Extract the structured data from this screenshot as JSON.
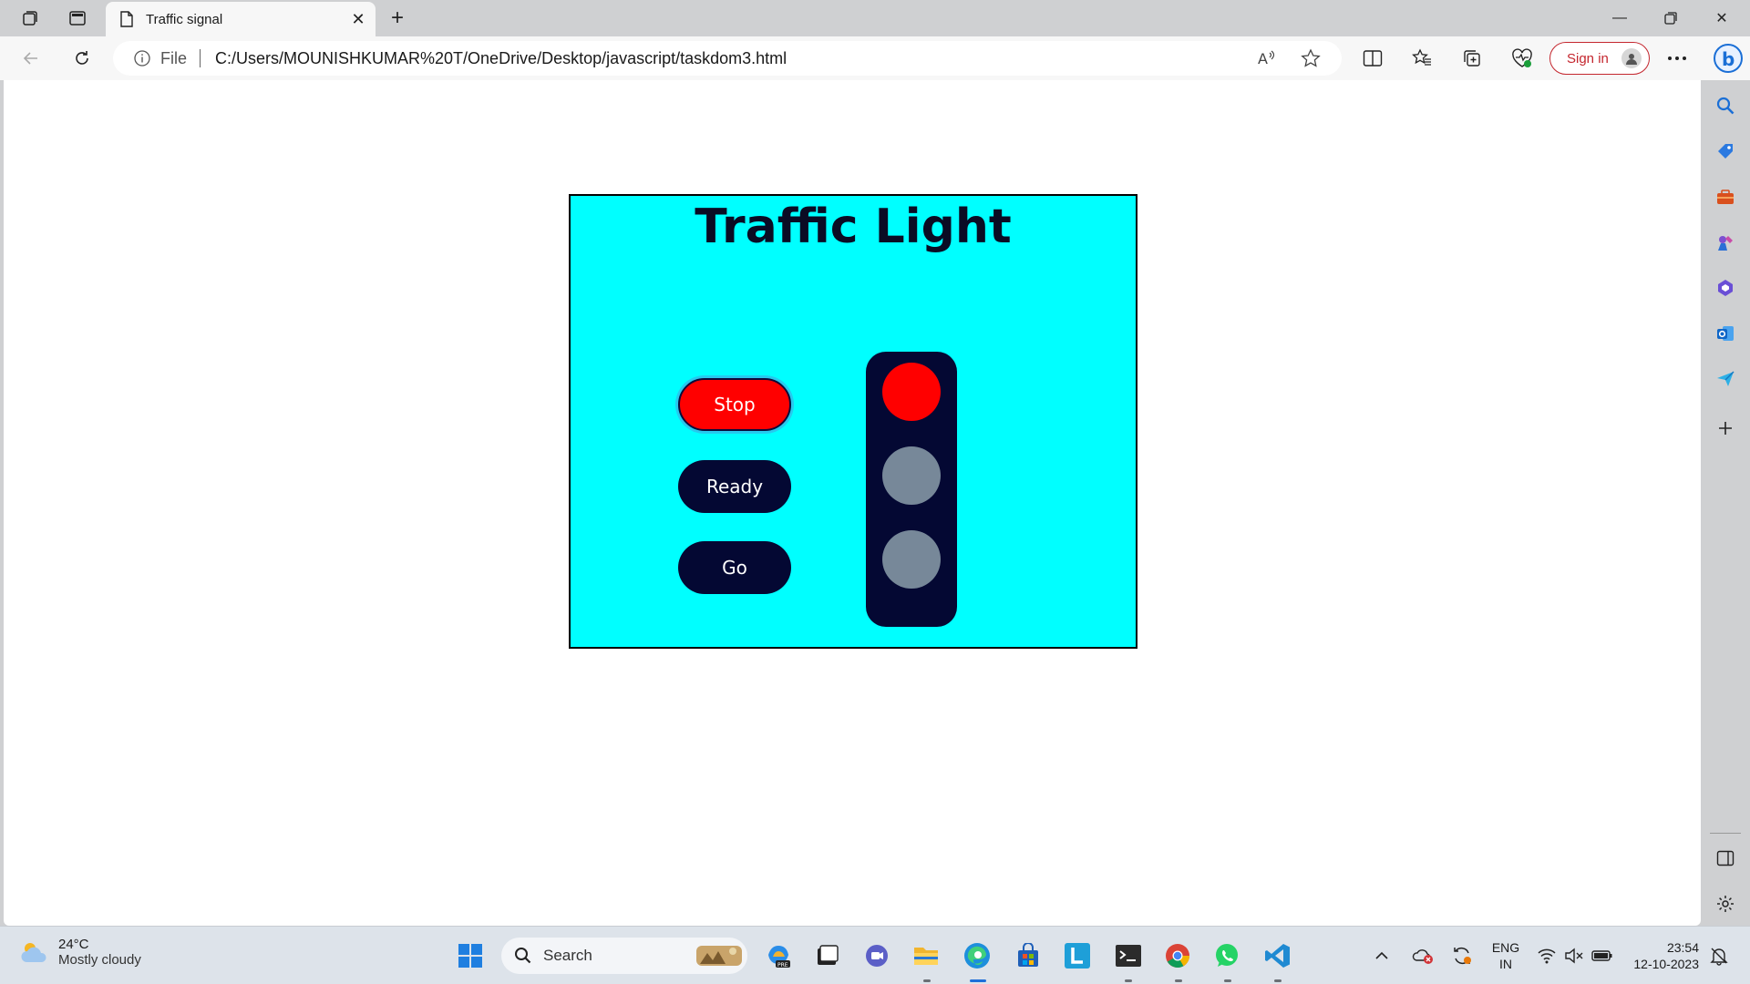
{
  "browser": {
    "tab_title": "Traffic signal",
    "address": {
      "file_label": "File",
      "url": "C:/Users/MOUNISHKUMAR%20T/OneDrive/Desktop/javascript/taskdom3.html"
    },
    "signin_label": "Sign in"
  },
  "page": {
    "title": "Traffic Light",
    "buttons": {
      "stop": "Stop",
      "ready": "Ready",
      "go": "Go"
    },
    "colors": {
      "panel_background": "#00ffff",
      "stop_button": "#ff0000",
      "button_dark": "#040833",
      "lamp_red_on": "#ff0000",
      "lamp_off": "#778899"
    },
    "active_light": "red"
  },
  "sidebar": {
    "icons": [
      "search-icon",
      "tag-icon",
      "toolbox-icon",
      "games-icon",
      "office-icon",
      "outlook-icon",
      "send-icon",
      "add-icon",
      "split-panel-icon",
      "settings-icon"
    ]
  },
  "taskbar": {
    "weather": {
      "temp": "24°C",
      "desc": "Mostly cloudy"
    },
    "search_label": "Search",
    "language": {
      "line1": "ENG",
      "line2": "IN"
    },
    "clock": {
      "time": "23:54",
      "date": "12-10-2023"
    }
  }
}
